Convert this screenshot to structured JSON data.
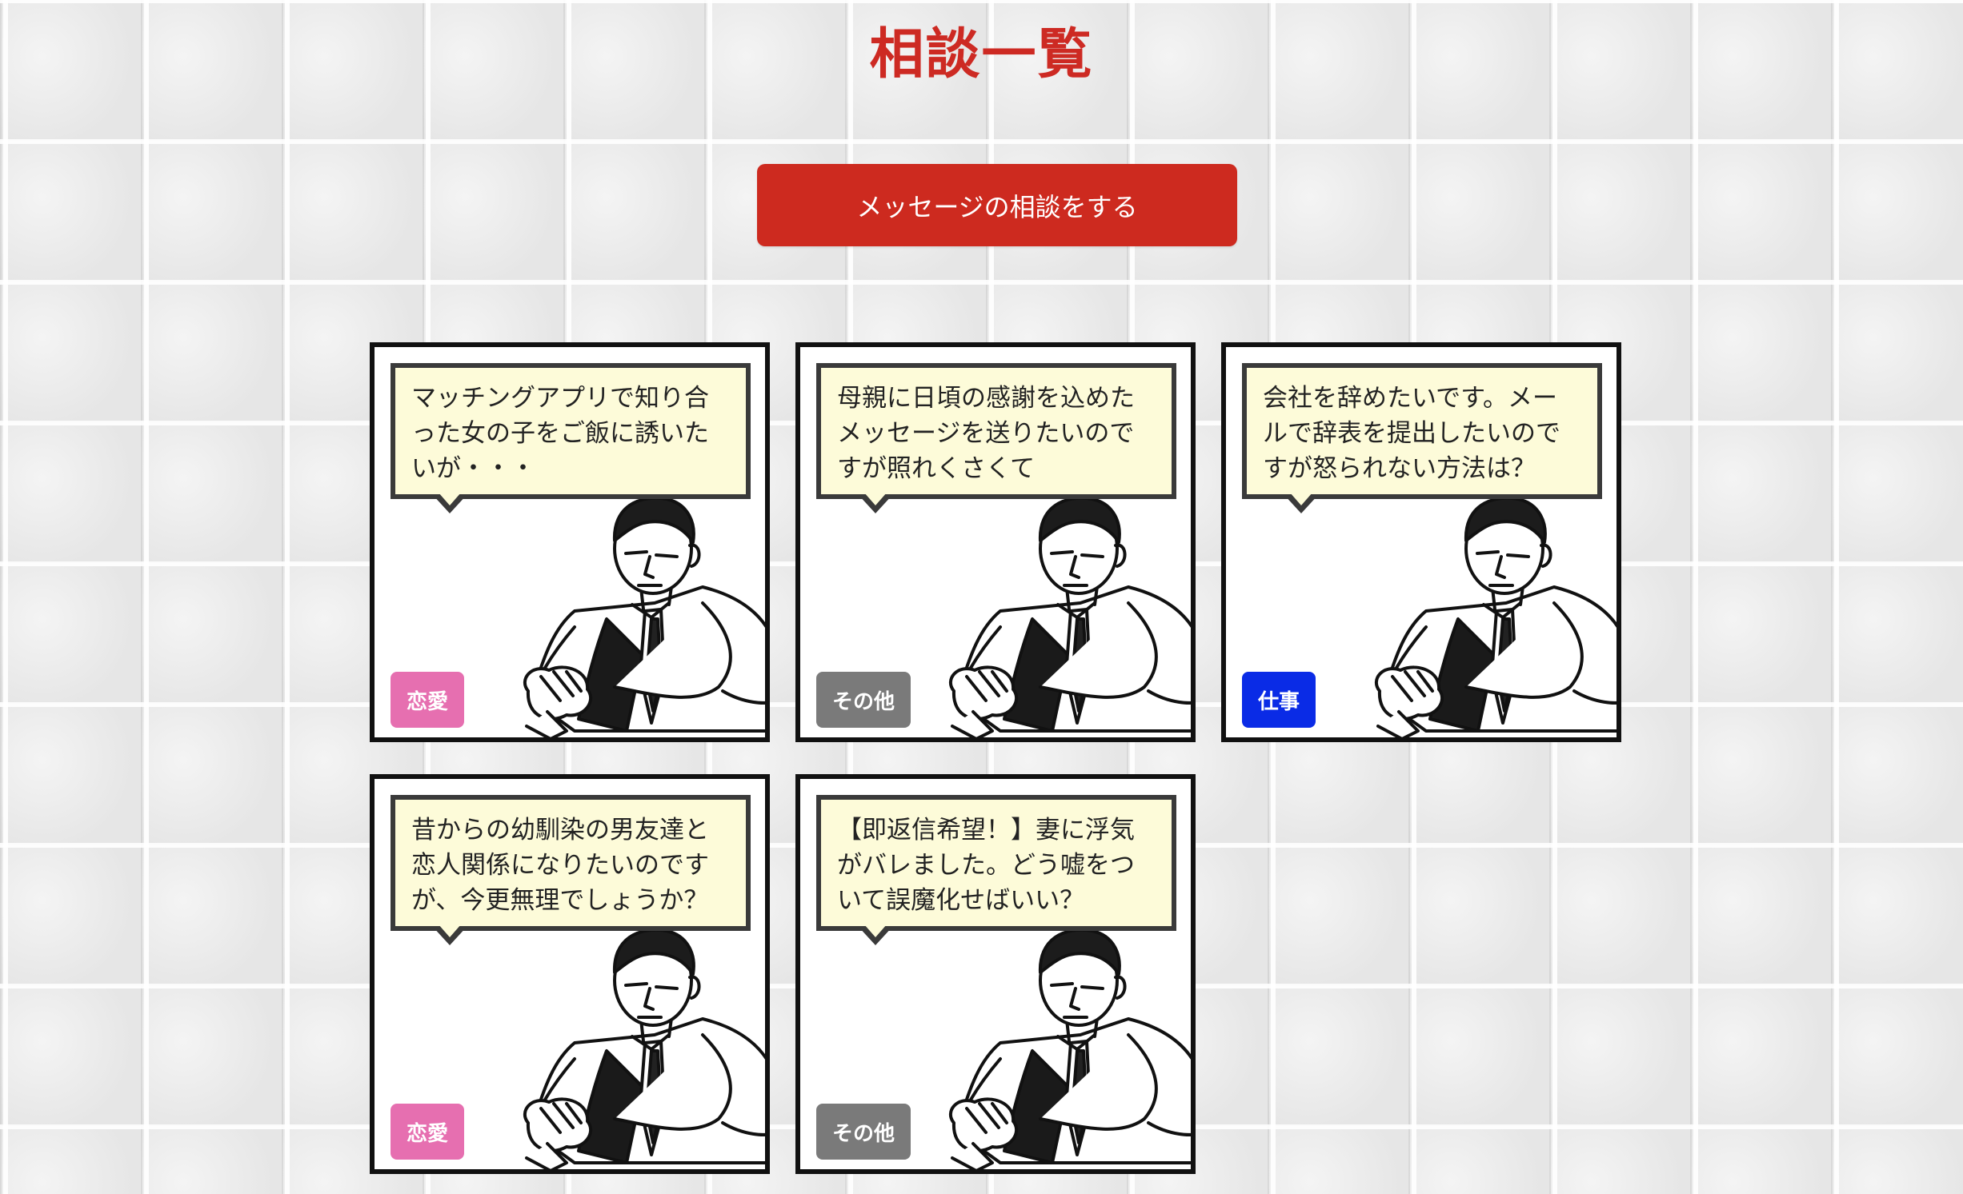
{
  "page": {
    "title": "相談一覧"
  },
  "cta": {
    "label": "メッセージの相談をする"
  },
  "colors": {
    "accent": "#cd2a1f",
    "bubble_fill": "#fdfbd9",
    "category_love": "#e66fb0",
    "category_other": "#7a7a7a",
    "category_work": "#0a2be6"
  },
  "cards": [
    {
      "text": "マッチングアプリで知り合った女の子をご飯に誘いたいが・・・",
      "category": "恋愛"
    },
    {
      "text": "母親に日頃の感謝を込めたメッセージを送りたいのですが照れくさくて",
      "category": "その他"
    },
    {
      "text": "会社を辞めたいです。メールで辞表を提出したいのですが怒られない方法は？",
      "category": "仕事"
    },
    {
      "text": "昔からの幼馴染の男友達と恋人関係になりたいのですが、今更無理でしょうか？",
      "category": "恋愛"
    },
    {
      "text": "【即返信希望！】妻に浮気がバレました。どう嘘をついて誤魔化せばいい？",
      "category": "その他"
    }
  ]
}
